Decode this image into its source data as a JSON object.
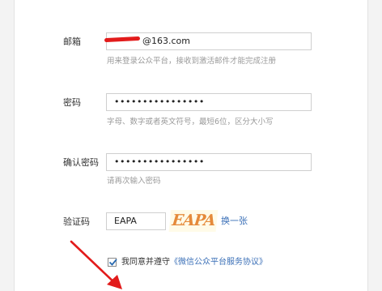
{
  "form": {
    "email": {
      "label": "邮箱",
      "value": "@163.com",
      "hint": "用来登录公众平台，接收到激活邮件才能完成注册"
    },
    "password": {
      "label": "密码",
      "value": "••••••••••••••••",
      "hint": "字母、数字或者英文符号，最短6位，区分大小写"
    },
    "confirm_password": {
      "label": "确认密码",
      "value": "••••••••••••••••",
      "hint": "请再次输入密码"
    },
    "captcha": {
      "label": "验证码",
      "value": "EAPA",
      "image_text": "EAPA",
      "refresh_label": "换一张"
    },
    "agreement": {
      "checked": true,
      "prefix": "我同意并遵守",
      "link": "《微信公众平台服务协议》"
    }
  },
  "colors": {
    "link": "#3a6fb7",
    "annotation": "#e21b1b",
    "hint": "#9a9a9a",
    "captcha": "#e58a3a"
  }
}
